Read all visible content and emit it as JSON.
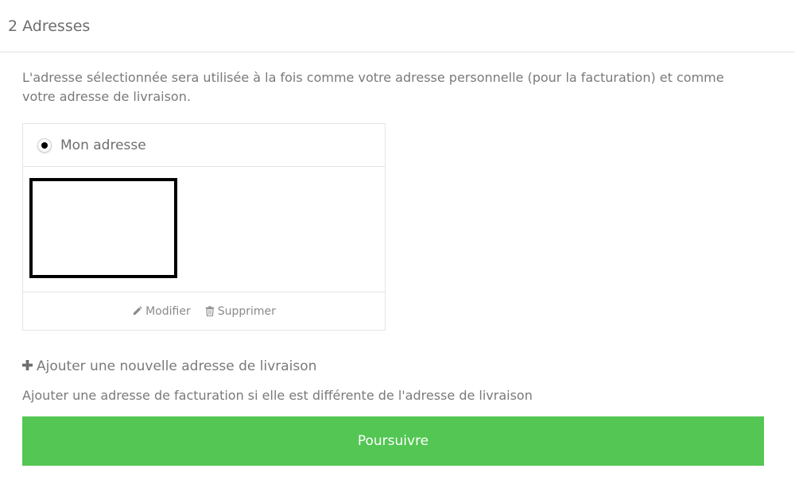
{
  "section": {
    "title": "2 Adresses"
  },
  "intro": "L'adresse sélectionnée sera utilisée à la fois comme votre adresse personnelle (pour la facturation) et comme votre adresse de livraison.",
  "address_card": {
    "title": "Mon adresse",
    "selected": true,
    "edit_label": "Modifier",
    "delete_label": "Supprimer"
  },
  "add_address_label": "Ajouter une nouvelle adresse de livraison",
  "billing_note": "Ajouter une adresse de facturation si elle est différente de l'adresse de livraison",
  "submit_label": "Poursuivre",
  "colors": {
    "accent": "#53c653",
    "text": "#7a7a7a",
    "border": "#e5e5e5"
  },
  "icons": {
    "edit": "pencil-icon",
    "delete": "trash-icon",
    "add": "plus-icon"
  }
}
